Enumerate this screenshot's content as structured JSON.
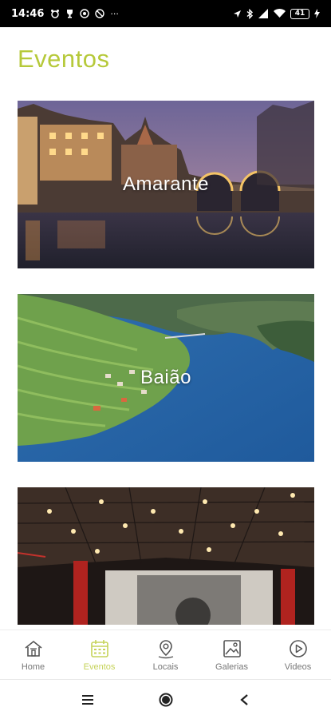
{
  "status_bar": {
    "time": "14:46",
    "more": "···",
    "battery": "41"
  },
  "page": {
    "title": "Eventos",
    "accent_color": "#b6c93a"
  },
  "events": [
    {
      "label": "Amarante"
    },
    {
      "label": "Baião"
    },
    {
      "label": ""
    }
  ],
  "bottom_nav": {
    "active_color": "#c6d35a",
    "items": [
      {
        "label": "Home",
        "icon": "home-icon"
      },
      {
        "label": "Eventos",
        "icon": "calendar-icon",
        "active": true
      },
      {
        "label": "Locais",
        "icon": "location-pin-icon"
      },
      {
        "label": "Galerias",
        "icon": "image-gallery-icon"
      },
      {
        "label": "Videos",
        "icon": "play-circle-icon"
      }
    ]
  },
  "system_nav": {
    "items": [
      "menu-icon",
      "home-circle-icon",
      "back-icon"
    ]
  }
}
